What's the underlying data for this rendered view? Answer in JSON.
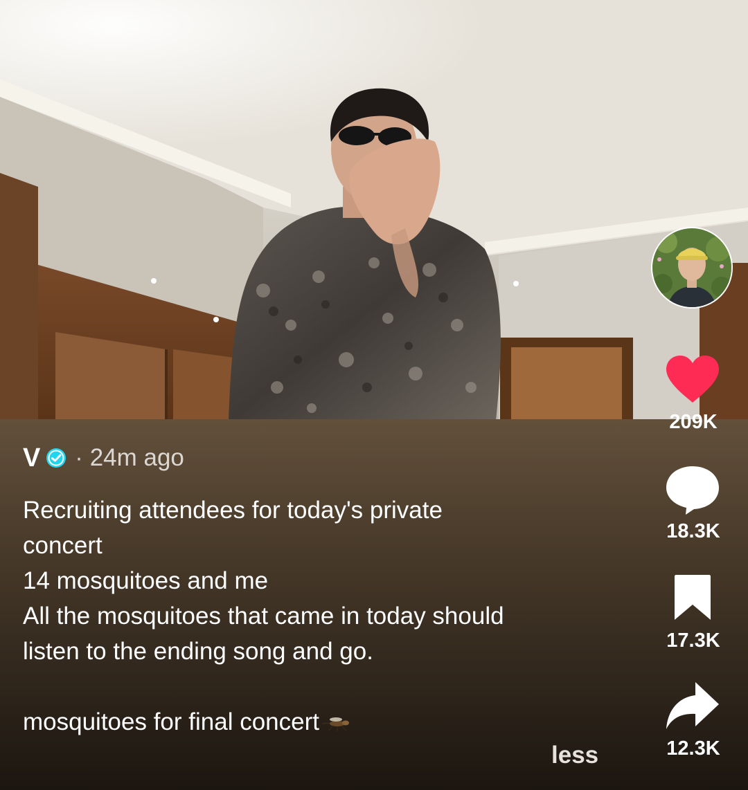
{
  "post": {
    "author": "V",
    "separator": "·",
    "time": "24m ago",
    "caption_lines": [
      "Recruiting attendees for today's private",
      "concert",
      "14 mosquitoes and me",
      "All the mosquitoes that came in today should",
      "listen to the ending song and go.",
      "",
      "mosquitoes for final concert"
    ],
    "less_label": "less"
  },
  "actions": {
    "likes": "209K",
    "comments": "18.3K",
    "saves": "17.3K",
    "shares": "12.3K"
  },
  "icons": {
    "verified": "verified-badge-icon",
    "like": "heart-icon",
    "comment": "comment-bubble-icon",
    "save": "bookmark-icon",
    "share": "share-arrow-icon",
    "emoji": "mosquito-emoji"
  },
  "colors": {
    "like_active": "#fe2c55",
    "verified": "#20d5ec",
    "text": "#ffffff"
  }
}
